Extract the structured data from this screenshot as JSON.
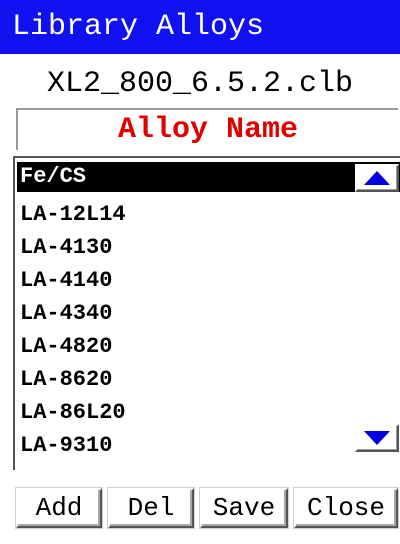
{
  "window": {
    "title": "Library Alloys"
  },
  "library": {
    "filename": "XL2_800_6.5.2.clb",
    "column_header": "Alloy Name"
  },
  "alloy_list": {
    "items": [
      {
        "label": "Fe/CS",
        "selected": true
      },
      {
        "label": "LA-12L14",
        "selected": false
      },
      {
        "label": "LA-4130",
        "selected": false
      },
      {
        "label": "LA-4140",
        "selected": false
      },
      {
        "label": "LA-4340",
        "selected": false
      },
      {
        "label": "LA-4820",
        "selected": false
      },
      {
        "label": "LA-8620",
        "selected": false
      },
      {
        "label": "LA-86L20",
        "selected": false
      },
      {
        "label": "LA-9310",
        "selected": false
      }
    ],
    "scroll_up_icon": "triangle-up-icon",
    "scroll_down_icon": "triangle-down-icon"
  },
  "buttons": {
    "add_label": "Add",
    "del_label": "Del",
    "save_label": "Save",
    "close_label": "Close"
  },
  "colors": {
    "title_bar_bg": "#1010f0",
    "title_text": "#ffffff",
    "header_text": "#e00000",
    "selection_bg": "#000000",
    "selection_text": "#ffffff",
    "arrow_color": "#0000e0"
  }
}
